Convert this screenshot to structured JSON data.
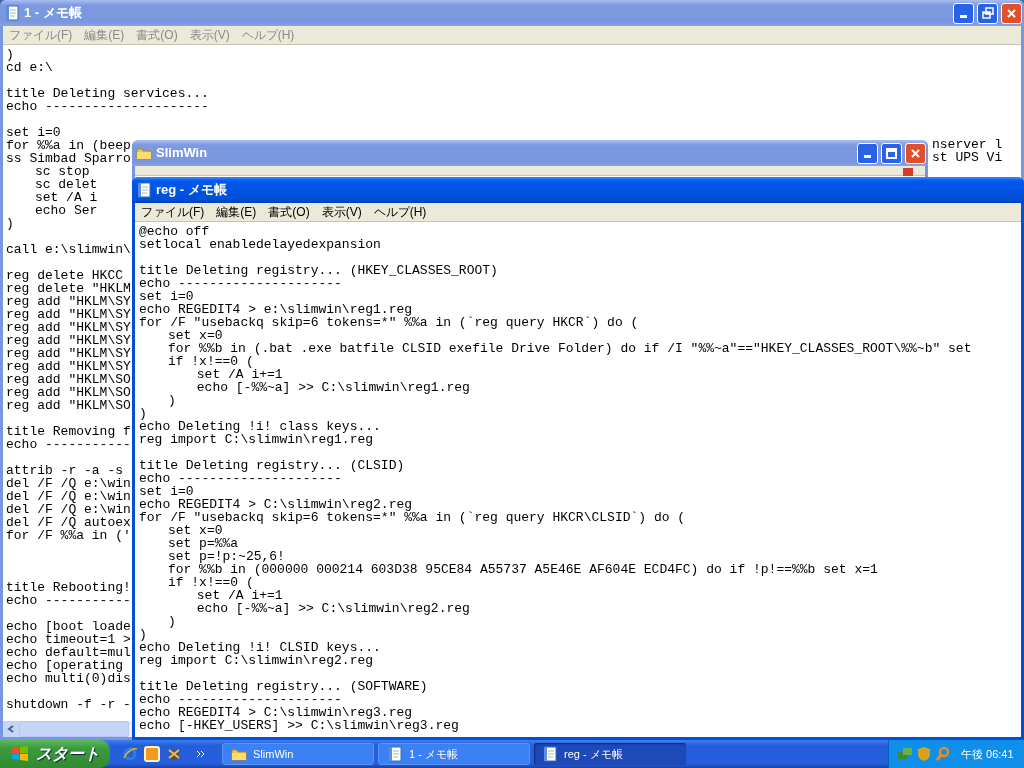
{
  "windows": [
    {
      "kind": "notepad",
      "title": "1 - メモ帳",
      "active": false,
      "maximized": true,
      "menu": [
        "ファイル(F)",
        "編集(E)",
        "書式(O)",
        "表示(V)",
        "ヘルプ(H)"
      ],
      "blocks": [
        {
          "lines": [
            ")",
            "cd e:\\"
          ]
        },
        {
          "lines": [
            "title Deleting services...",
            "echo ---------------------"
          ]
        },
        {
          "lines": [
            "set i=0",
            {
              "text": "for %%a in (beep",
              "tail": "nserver l"
            },
            {
              "text": "ss Simbad Sparro",
              "tail": "st UPS Vi"
            },
            "\tsc stop",
            "\tsc delet",
            "\tset /A i",
            "\techo Ser",
            ")"
          ]
        },
        {
          "lines": [
            "call e:\\slimwin\\"
          ]
        },
        {
          "lines": [
            "reg delete HKCC",
            "reg delete \"HKLM",
            "reg add \"HKLM\\SY",
            "reg add \"HKLM\\SY",
            "reg add \"HKLM\\SY",
            "reg add \"HKLM\\SY",
            "reg add \"HKLM\\SY",
            "reg add \"HKLM\\SY",
            "reg add \"HKLM\\SO",
            "reg add \"HKLM\\SO",
            "reg add \"HKLM\\SO"
          ]
        },
        {
          "lines": [
            "title Removing f",
            "echo -----------"
          ]
        },
        {
          "lines": [
            "attrib -r -a -s",
            "del /F /Q e:\\win",
            "del /F /Q e:\\win",
            "del /F /Q e:\\win",
            "del /F /Q autoex",
            "for /F %%a in ('"
          ]
        },
        {
          "wide_gap": true,
          "lines": [
            "title Rebooting!",
            "echo -----------"
          ]
        },
        {
          "lines": [
            "echo [boot loade",
            "echo timeout=1 >",
            "echo default=mul",
            "echo [operating",
            "echo multi(0)dis"
          ]
        },
        {
          "lines": [
            "shutdown -f -r -"
          ]
        }
      ]
    },
    {
      "kind": "explorer",
      "title": "SlimWin",
      "active": false,
      "maximized": false
    },
    {
      "kind": "notepad",
      "title": "reg - メモ帳",
      "active": true,
      "menu": [
        "ファイル(F)",
        "編集(E)",
        "書式(O)",
        "表示(V)",
        "ヘルプ(H)"
      ],
      "blocks": [
        {
          "lines": [
            "@echo off",
            "setlocal enabledelayedexpansion"
          ]
        },
        {
          "lines": [
            "title Deleting registry... (HKEY_CLASSES_ROOT)",
            "echo ---------------------",
            "set i=0",
            "echo REGEDIT4 > e:\\slimwin\\reg1.reg",
            "for /F \"usebackq skip=6 tokens=*\" %%a in (`reg query HKCR`) do (",
            "\tset x=0",
            "\tfor %%b in (.bat .exe batfile CLSID exefile Drive Folder) do if /I \"%%~a\"==\"HKEY_CLASSES_ROOT\\%%~b\" set",
            "\tif !x!==0 (",
            "\t\tset /A i+=1",
            "\t\techo [-%%~a] >> C:\\slimwin\\reg1.reg",
            "\t)",
            ")",
            "echo Deleting !i! class keys...",
            "reg import C:\\slimwin\\reg1.reg"
          ]
        },
        {
          "lines": [
            "title Deleting registry... (CLSID)",
            "echo ---------------------",
            "set i=0",
            "echo REGEDIT4 > C:\\slimwin\\reg2.reg",
            "for /F \"usebackq skip=6 tokens=*\" %%a in (`reg query HKCR\\CLSID`) do (",
            "\tset x=0",
            "\tset p=%%a",
            "\tset p=!p:~25,6!",
            "\tfor %%b in (000000 000214 603D38 95CE84 A55737 A5E46E AF604E ECD4FC) do if !p!==%%b set x=1",
            "\tif !x!==0 (",
            "\t\tset /A i+=1",
            "\t\techo [-%%~a] >> C:\\slimwin\\reg2.reg",
            "\t)",
            ")",
            "echo Deleting !i! CLSID keys...",
            "reg import C:\\slimwin\\reg2.reg"
          ]
        },
        {
          "lines": [
            "title Deleting registry... (SOFTWARE)",
            "echo ---------------------",
            "echo REGEDIT4 > C:\\slimwin\\reg3.reg",
            "echo [-HKEY_USERS] >> C:\\slimwin\\reg3.reg"
          ]
        }
      ]
    }
  ],
  "taskbar": {
    "start": "スタート",
    "tasks": [
      {
        "kind": "folder",
        "label": "SlimWin",
        "selected": false
      },
      {
        "kind": "notepad",
        "label": "1 - メモ帳",
        "selected": false
      },
      {
        "kind": "notepad",
        "label": "reg - メモ帳",
        "selected": true
      }
    ],
    "clock": "午後 06:41"
  }
}
